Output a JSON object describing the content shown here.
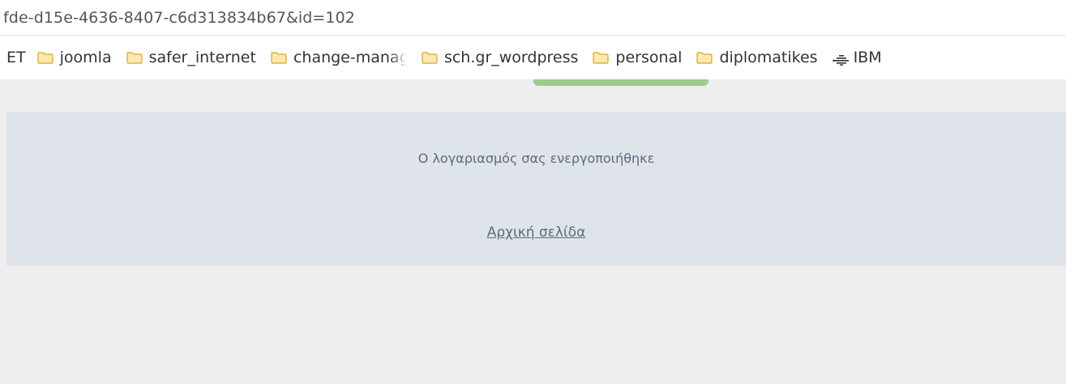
{
  "browser": {
    "address_text": "fde-d15e-4636-8407-c6d313834b67&id=102",
    "bookmarks": [
      {
        "label": "ET",
        "icon": "none"
      },
      {
        "label": "joomla",
        "icon": "folder-icon"
      },
      {
        "label": "safer_internet",
        "icon": "folder-icon"
      },
      {
        "label": "change-managm",
        "icon": "folder-icon"
      },
      {
        "label": "sch.gr_wordpress",
        "icon": "folder-icon"
      },
      {
        "label": "personal",
        "icon": "folder-icon"
      },
      {
        "label": "diplomatikes",
        "icon": "folder-icon"
      },
      {
        "label": "IBM",
        "icon": "ibm-logo-icon"
      }
    ]
  },
  "page": {
    "message": "Ο λογαριασμός σας ενεργοποιήθηκε",
    "home_link": "Αρχική σελίδα"
  },
  "colors": {
    "page_background": "#eeeeee",
    "panel_background": "#dfe4ea",
    "text_color": "#5b6b7d",
    "green_accent": "#9ccc8c",
    "folder_yellow": "#f5c542"
  }
}
